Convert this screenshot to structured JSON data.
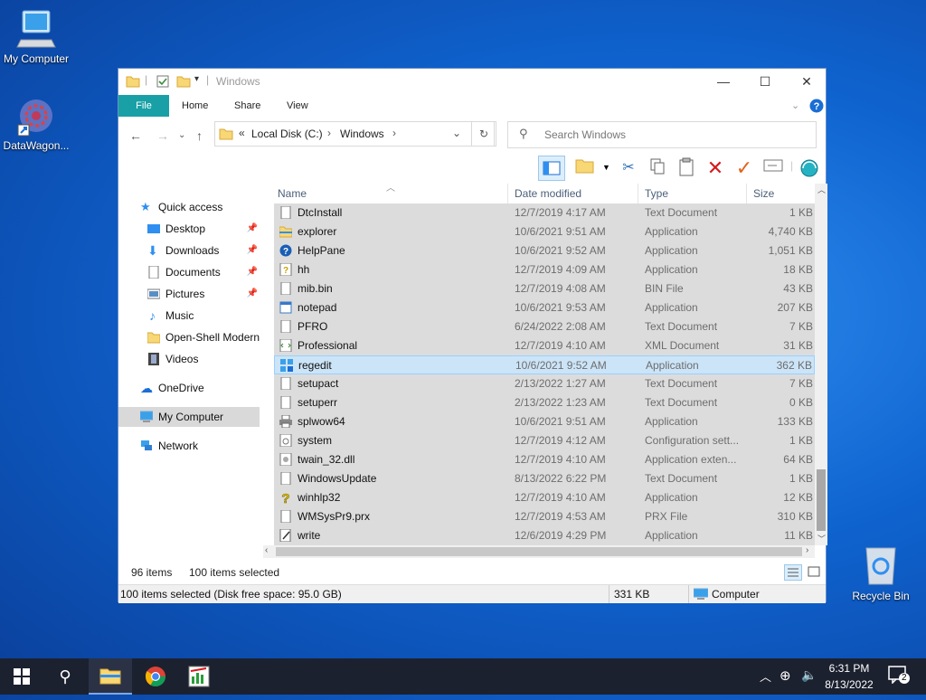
{
  "desktop": {
    "icons": [
      {
        "label": "My Computer"
      },
      {
        "label": "DataWagon..."
      },
      {
        "label": "Recycle Bin"
      }
    ]
  },
  "window": {
    "title": "Windows",
    "tabs": [
      {
        "label": "File"
      },
      {
        "label": "Home"
      },
      {
        "label": "Share"
      },
      {
        "label": "View"
      }
    ],
    "address": {
      "prefix": "«",
      "crumbs": [
        "Local Disk (C:)",
        "Windows"
      ],
      "separator": "›"
    },
    "search_placeholder": "Search Windows"
  },
  "nav": {
    "items": [
      {
        "label": "Quick access"
      },
      {
        "label": "Desktop"
      },
      {
        "label": "Downloads"
      },
      {
        "label": "Documents"
      },
      {
        "label": "Pictures"
      },
      {
        "label": "Music"
      },
      {
        "label": "Open-Shell Modern"
      },
      {
        "label": "Videos"
      },
      {
        "label": "OneDrive"
      },
      {
        "label": "My Computer"
      },
      {
        "label": "Network"
      }
    ]
  },
  "list": {
    "columns": {
      "name": "Name",
      "date": "Date modified",
      "type": "Type",
      "size": "Size"
    },
    "rows": [
      {
        "name": "DtcInstall",
        "date": "12/7/2019 4:17 AM",
        "type": "Text Document",
        "size": "1 KB"
      },
      {
        "name": "explorer",
        "date": "10/6/2021 9:51 AM",
        "type": "Application",
        "size": "4,740 KB"
      },
      {
        "name": "HelpPane",
        "date": "10/6/2021 9:52 AM",
        "type": "Application",
        "size": "1,051 KB"
      },
      {
        "name": "hh",
        "date": "12/7/2019 4:09 AM",
        "type": "Application",
        "size": "18 KB"
      },
      {
        "name": "mib.bin",
        "date": "12/7/2019 4:08 AM",
        "type": "BIN File",
        "size": "43 KB"
      },
      {
        "name": "notepad",
        "date": "10/6/2021 9:53 AM",
        "type": "Application",
        "size": "207 KB"
      },
      {
        "name": "PFRO",
        "date": "6/24/2022 2:08 AM",
        "type": "Text Document",
        "size": "7 KB"
      },
      {
        "name": "Professional",
        "date": "12/7/2019 4:10 AM",
        "type": "XML Document",
        "size": "31 KB"
      },
      {
        "name": "regedit",
        "date": "10/6/2021 9:52 AM",
        "type": "Application",
        "size": "362 KB"
      },
      {
        "name": "setupact",
        "date": "2/13/2022 1:27 AM",
        "type": "Text Document",
        "size": "7 KB"
      },
      {
        "name": "setuperr",
        "date": "2/13/2022 1:23 AM",
        "type": "Text Document",
        "size": "0 KB"
      },
      {
        "name": "splwow64",
        "date": "10/6/2021 9:51 AM",
        "type": "Application",
        "size": "133 KB"
      },
      {
        "name": "system",
        "date": "12/7/2019 4:12 AM",
        "type": "Configuration sett...",
        "size": "1 KB"
      },
      {
        "name": "twain_32.dll",
        "date": "12/7/2019 4:10 AM",
        "type": "Application exten...",
        "size": "64 KB"
      },
      {
        "name": "WindowsUpdate",
        "date": "8/13/2022 6:22 PM",
        "type": "Text Document",
        "size": "1 KB"
      },
      {
        "name": "winhlp32",
        "date": "12/7/2019 4:10 AM",
        "type": "Application",
        "size": "12 KB"
      },
      {
        "name": "WMSysPr9.prx",
        "date": "12/7/2019 4:53 AM",
        "type": "PRX File",
        "size": "310 KB"
      },
      {
        "name": "write",
        "date": "12/6/2019 4:29 PM",
        "type": "Application",
        "size": "11 KB"
      }
    ]
  },
  "status": {
    "item_count": "96 items",
    "selected_count": "100 items selected",
    "detail": "100 items selected (Disk free space: 95.0 GB)",
    "size": "331 KB",
    "location": "Computer"
  },
  "taskbar": {
    "time": "6:31 PM",
    "date": "8/13/2022",
    "notification_count": "2"
  },
  "colors": {
    "accent": "#19a0a6",
    "selected_row": "#dcdcdc",
    "highlight_row": "#cce4f7",
    "taskbar": "#1c2130"
  }
}
